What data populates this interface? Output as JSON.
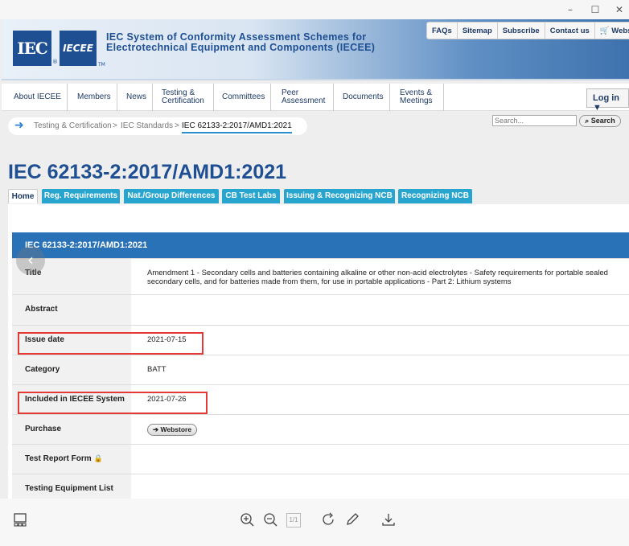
{
  "window": {
    "minimize": "–",
    "maximize": "☐",
    "close": "✕"
  },
  "banner": {
    "logo_iec": "IEC",
    "logo_iecee": "IECEE",
    "title": "IEC System of Conformity Assessment Schemes for Electrotechnical Equipment and Components (IECEE)",
    "toplinks": [
      "FAQs",
      "Sitemap",
      "Subscribe",
      "Contact us",
      "🛒 Webstore"
    ]
  },
  "nav": {
    "items": [
      "About IECEE",
      "Members",
      "News",
      "Testing & Certification",
      "Committees",
      "Peer Assessment",
      "Documents",
      "Events & Meetings"
    ],
    "login": "Log in ▼"
  },
  "breadcrumb": {
    "items": [
      "Testing & Certification",
      "IEC Standards",
      "IEC 62133-2:2017/AMD1:2021"
    ],
    "separator": ">"
  },
  "search": {
    "placeholder": "Search...",
    "button": "Search"
  },
  "page": {
    "heading": "IEC 62133-2:2017/AMD1:2021",
    "tabs": [
      "Home",
      "Reg. Requirements",
      "Nat./Group Differences",
      "CB Test Labs",
      "Issuing & Recognizing NCB",
      "Recognizing NCB"
    ],
    "active_tab": "Home"
  },
  "detail": {
    "header": "IEC 62133-2:2017/AMD1:2021",
    "rows": [
      {
        "label": "Title",
        "value": "Amendment 1 - Secondary cells and batteries containing alkaline or other non-acid electrolytes - Safety requirements for portable sealed secondary cells, and for batteries made from them, for use in portable applications - Part 2: Lithium systems"
      },
      {
        "label": "Abstract",
        "value": ""
      },
      {
        "label": "Issue date",
        "value": "2021-07-15"
      },
      {
        "label": "Category",
        "value": "BATT"
      },
      {
        "label": "Included in IECEE System",
        "value": "2021-07-26"
      },
      {
        "label": "Purchase",
        "button": "Webstore"
      },
      {
        "label": "Test Report Form",
        "value": ""
      },
      {
        "label": "Testing Equipment List",
        "value": ""
      }
    ]
  },
  "colors": {
    "brand": "#1e4f93",
    "tab": "#28a5cf",
    "header_bar": "#2a72b8",
    "highlight": "#e53935"
  },
  "toolbar": {
    "page_indicator": "1/1"
  }
}
